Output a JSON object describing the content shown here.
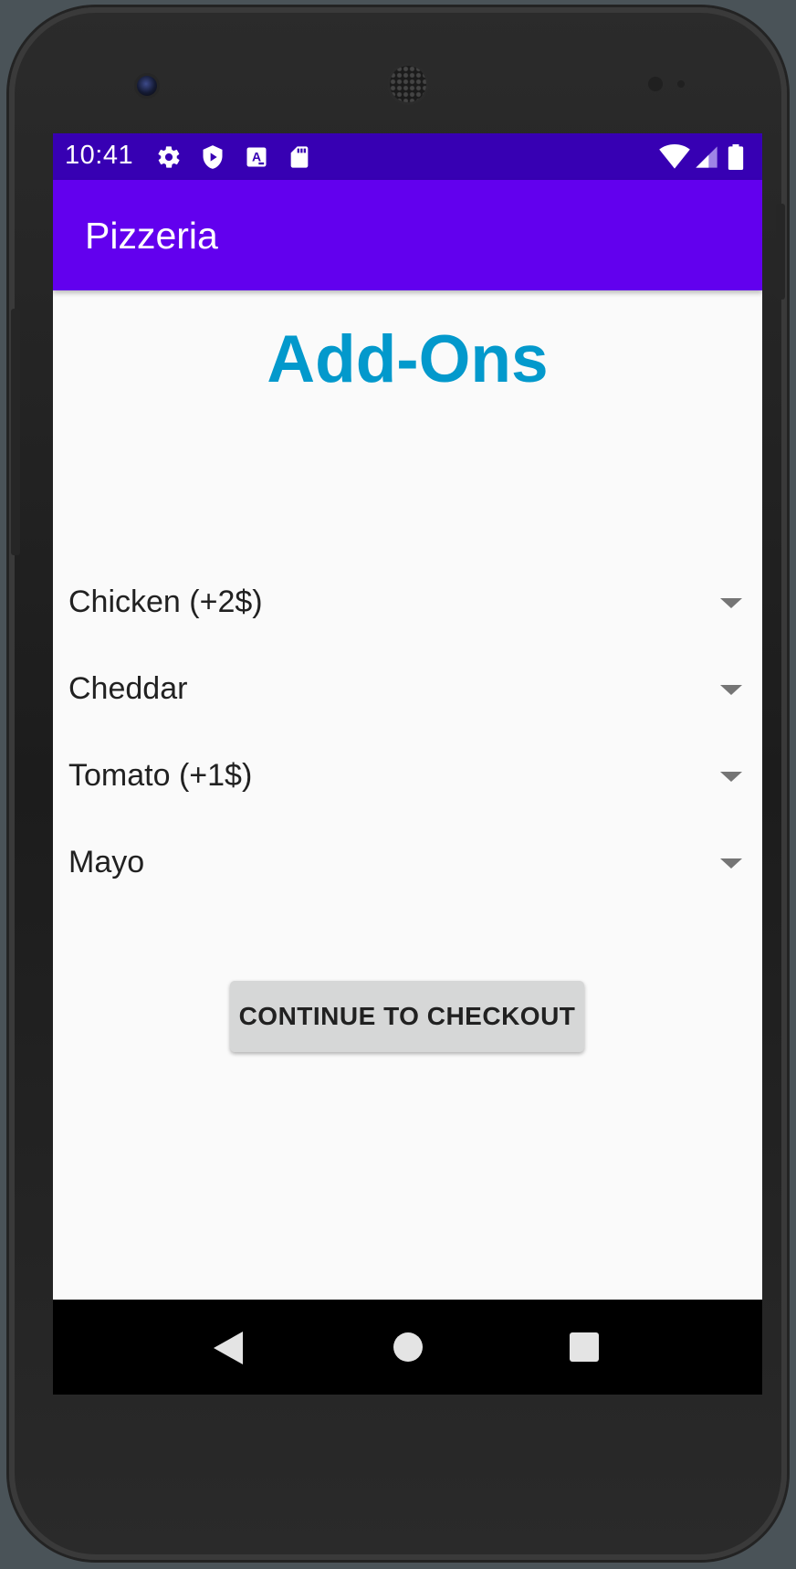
{
  "status_bar": {
    "time": "10:41",
    "left_icons": [
      "gear-icon",
      "shield-play-icon",
      "a-badge-icon",
      "sd-card-icon"
    ],
    "right_icons": [
      "wifi-icon",
      "cell-signal-icon",
      "battery-icon"
    ]
  },
  "app_bar": {
    "title": "Pizzeria"
  },
  "main": {
    "heading": "Add-Ons",
    "spinners": [
      {
        "label": "Chicken (+2$)"
      },
      {
        "label": "Cheddar"
      },
      {
        "label": "Tomato (+1$)"
      },
      {
        "label": "Mayo"
      }
    ],
    "checkout_label": "CONTINUE TO CHECKOUT"
  },
  "nav_bar": {
    "buttons": [
      "back-icon",
      "home-icon",
      "recents-icon"
    ]
  },
  "colors": {
    "status_bar": "#3700b3",
    "app_bar": "#6200ee",
    "heading": "#0399cc",
    "background": "#fafafa",
    "button": "#d6d7d7"
  }
}
